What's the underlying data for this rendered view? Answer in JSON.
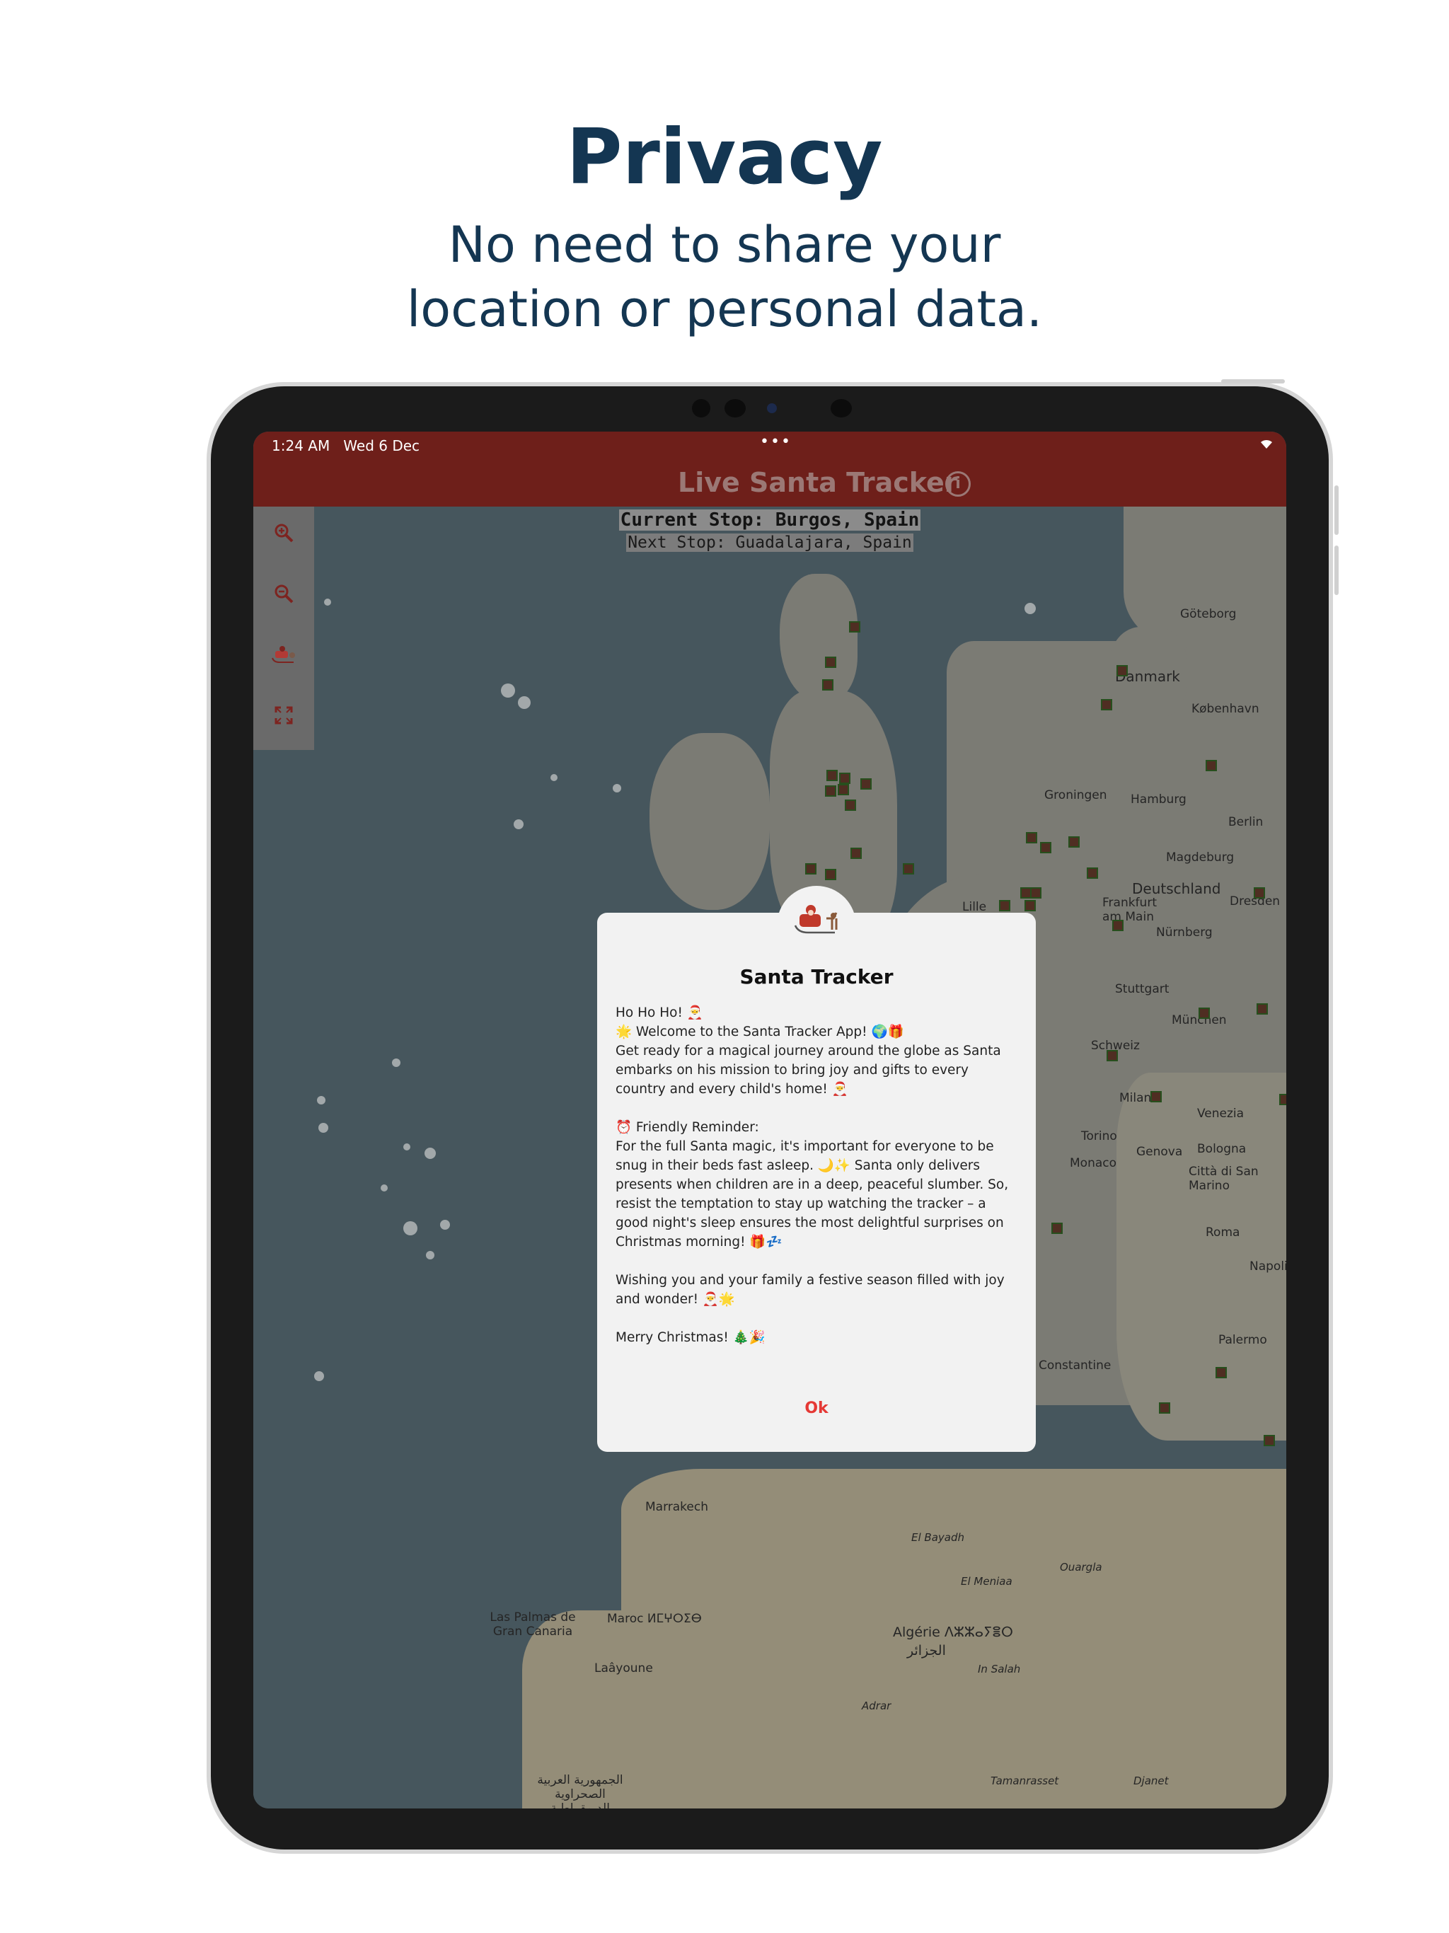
{
  "headline": {
    "title": "Privacy",
    "subtitle_line1": "No need to share your",
    "subtitle_line2": "location or personal data."
  },
  "status_bar": {
    "time": "1:24 AM",
    "date": "Wed 6 Dec",
    "dots": "•••",
    "wifi_icon": "wifi-icon"
  },
  "app_bar": {
    "title": "Live Santa Tracker",
    "info_icon": "info-icon"
  },
  "stops": {
    "current": "Current Stop: Burgos, Spain",
    "next": "Next Stop: Guadalajara, Spain"
  },
  "map_controls": {
    "zoom_in_icon": "zoom-in-icon",
    "zoom_out_icon": "zoom-out-icon",
    "santa_icon": "santa-sleigh-icon",
    "fullscreen_icon": "fullscreen-icon"
  },
  "map_labels": {
    "goteborg": "Göteborg",
    "danmark": "Danmark",
    "kobenhavn": "København",
    "hamburg": "Hamburg",
    "groningen": "Groningen",
    "berlin": "Berlin",
    "deutschland": "Deutschland",
    "dresden": "Dresden",
    "frankfurt": "Frankfurt am Main",
    "nurnberg": "Nürnberg",
    "stuttgart": "Stuttgart",
    "munchen": "München",
    "magdeburg": "Magdeburg",
    "schweiz": "Schweiz",
    "milano": "Milano",
    "venezia": "Venezia",
    "torino": "Torino",
    "genova": "Genova",
    "bologna": "Bologna",
    "monaco": "Monaco",
    "san_marino": "Città di San Marino",
    "roma": "Roma",
    "napoli": "Napoli",
    "palermo": "Palermo",
    "constantine": "Constantine",
    "marrakech": "Marrakech",
    "las_palmas": "Las Palmas de Gran Canaria",
    "maroc": "Maroc ⵍⵎⵖⵔⵉⴱ",
    "algerie": "Algérie ⴷⵣⵣⴰⵢⴻⵔ",
    "algerie_ar": "الجزائر",
    "el_bayadh": "El Bayadh",
    "el_menia": "El Meniaa",
    "ouargla": "Ouargla",
    "in_salah": "In Salah",
    "adrar": "Adrar",
    "tamanrasset": "Tamanrasset",
    "djanet": "Djanet",
    "laayoune": "Laâyoune",
    "lille": "Lille",
    "sahrawi": "الجمهورية العربية الصحراوية الديمقراطية"
  },
  "dialog": {
    "badge_icon": "santa-sleigh-icon",
    "title": "Santa Tracker",
    "line1": "Ho Ho Ho! 🎅",
    "line2": "🌟 Welcome to the Santa Tracker App! 🌍🎁",
    "line3": "Get ready for a magical journey around the globe as Santa embarks on his mission to bring joy and gifts to every country and every child's home! 🎅",
    "line4": "⏰ Friendly Reminder:",
    "line5": "For the full Santa magic, it's important for everyone to be snug in their beds fast asleep. 🌙✨ Santa only delivers presents when children are in a deep, peaceful slumber. So, resist the temptation to stay up watching the tracker – a good night's sleep ensures the most delightful surprises on Christmas morning! 🎁💤",
    "line6": "Wishing you and your family a festive season filled with joy and wonder! 🎅🌟",
    "line7": "Merry Christmas! 🎄🎉",
    "ok_label": "Ok"
  }
}
